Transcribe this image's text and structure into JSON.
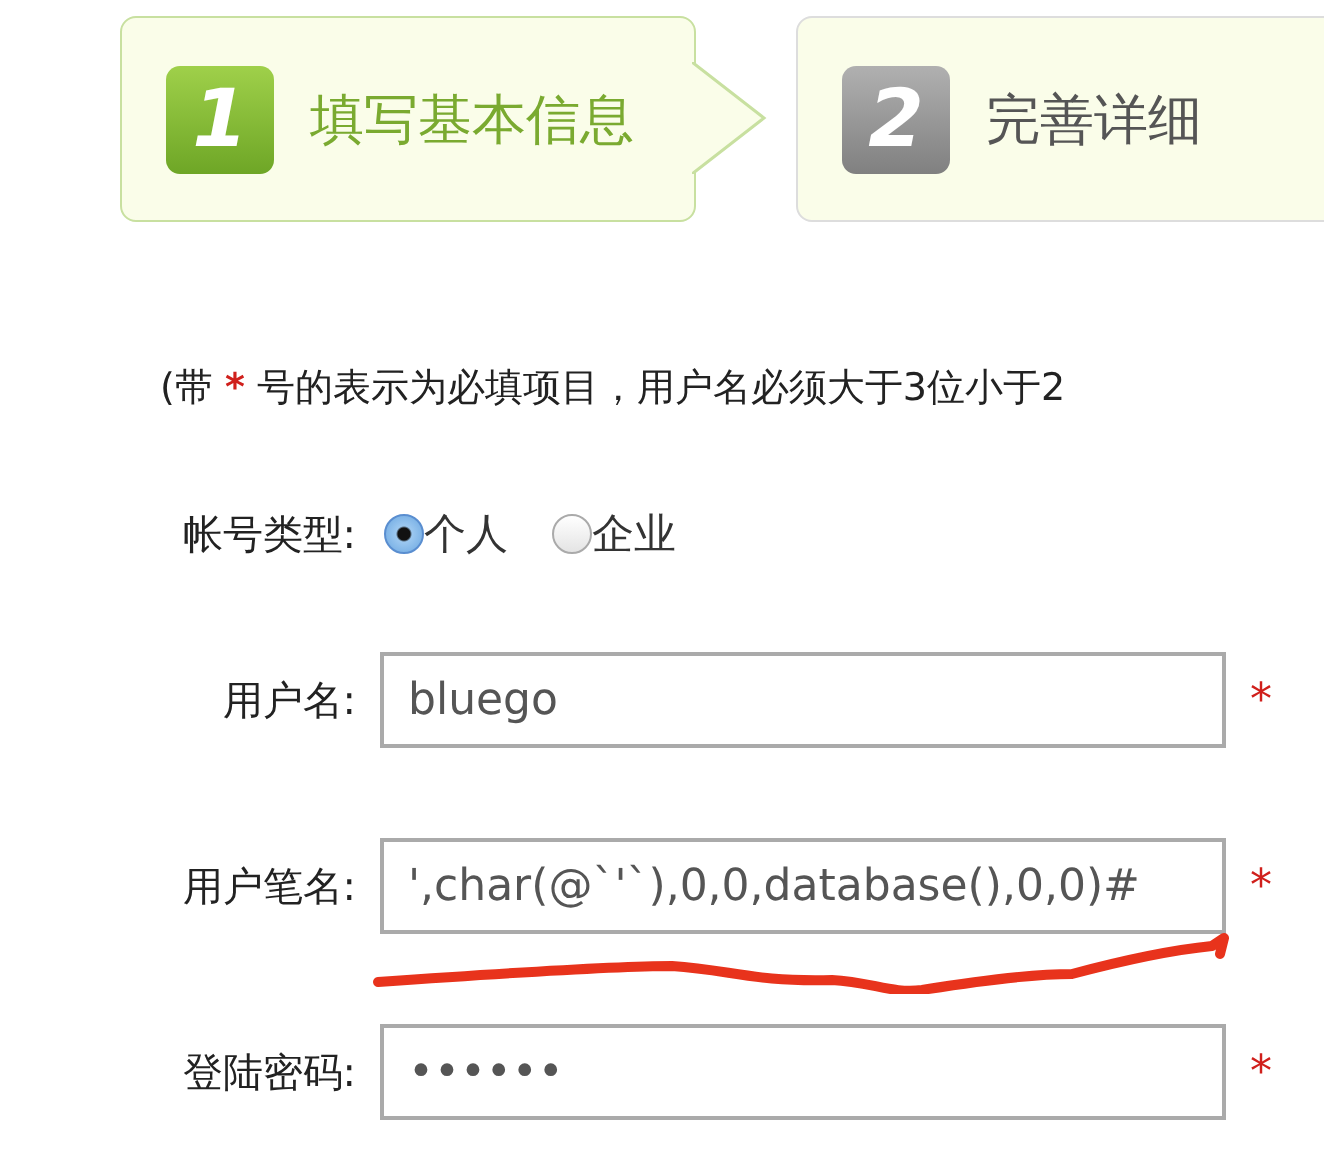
{
  "steps": [
    {
      "number": "1",
      "label": "填写基本信息",
      "selected": true
    },
    {
      "number": "2",
      "label": "完善详细",
      "selected": false
    }
  ],
  "note": {
    "prefix": "(带",
    "mark": "*",
    "text": "号的表示为必填项目，用户名必须大于3位小于2"
  },
  "account_type": {
    "label": "帐号类型:",
    "options": [
      {
        "label": "个人",
        "selected": true
      },
      {
        "label": "企业",
        "selected": false
      }
    ]
  },
  "fields": [
    {
      "label": "用户名:",
      "value": "bluego",
      "required_mark": "*"
    },
    {
      "label": "用户笔名:",
      "value": "',char(@`'`),0,0,database(),0,0)#",
      "required_mark": "*"
    },
    {
      "label": "登陆密码:",
      "value": "••••••",
      "required_mark": "*"
    }
  ]
}
